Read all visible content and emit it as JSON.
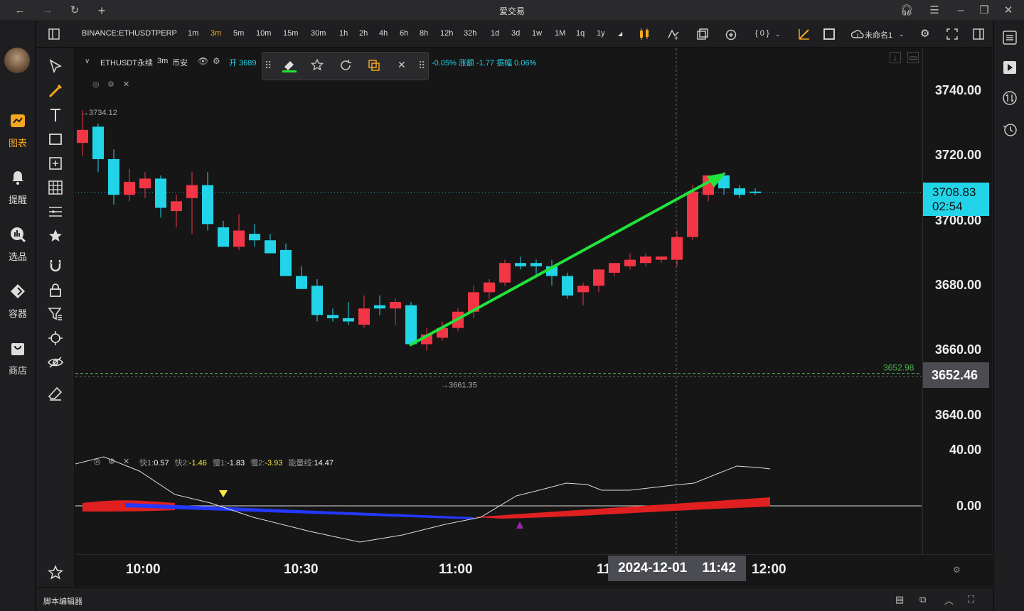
{
  "window": {
    "title": "爱交易"
  },
  "nav": {
    "items": [
      {
        "label": "图表",
        "active": true,
        "icon": "chart-icon"
      },
      {
        "label": "提醒",
        "icon": "bell-icon"
      },
      {
        "label": "选品",
        "icon": "screener-icon"
      },
      {
        "label": "容器",
        "icon": "container-icon"
      },
      {
        "label": "商店",
        "icon": "store-icon"
      }
    ]
  },
  "toolbar": {
    "symbol": "BINANCE:ETHUSDTPERP",
    "intervals": [
      "1m",
      "3m",
      "5m",
      "10m",
      "15m",
      "30m",
      "1h",
      "2h",
      "4h",
      "6h",
      "8h",
      "12h",
      "32h",
      "1d",
      "3d",
      "1w",
      "1M",
      "1q",
      "1y"
    ],
    "active_interval": "3m",
    "indicator_count": "{ 0 }",
    "layout_name": "未命名1"
  },
  "legend": {
    "name": "ETHUSDT永续",
    "interval": "3m",
    "exchange": "币安",
    "open_label": "开 3689",
    "change_text": "-0.05% 涨额 -1.77 振幅 0.06%"
  },
  "price_labels": {
    "high": "→3734.12",
    "low": "→3661.35",
    "line_label": "3652.98"
  },
  "price_axis": [
    "3740.00",
    "3720.00",
    "3700.00",
    "3680.00",
    "3660.00",
    "3640.00"
  ],
  "current_price": {
    "price": "3708.83",
    "countdown": "02:54"
  },
  "crosshair_price": "3652.46",
  "indicator": {
    "legend": [
      {
        "label": "快1:",
        "value": "0.57",
        "color": "#ffffff"
      },
      {
        "label": "快2:",
        "value": "-1.46",
        "color": "#ffeb3b"
      },
      {
        "label": "慢1:",
        "value": "-1.83",
        "color": "#ffffff"
      },
      {
        "label": "慢2:",
        "value": "-3.93",
        "color": "#ffeb3b"
      },
      {
        "label": "能量线:",
        "value": "14.47",
        "color": "#ffffff"
      }
    ],
    "axis": [
      "40.00",
      "0.00"
    ]
  },
  "time_axis": {
    "ticks": [
      "10:00",
      "10:30",
      "11:00",
      "11:42",
      "12:00"
    ],
    "crosshair_date": "2024-12-01",
    "crosshair_time": "11:42"
  },
  "bottom": {
    "label": "脚本编辑器"
  },
  "colors": {
    "up": "#f23645",
    "down": "#22d4e8",
    "arrow": "#21e33a"
  },
  "chart_data": {
    "type": "candlestick",
    "interval": "3m",
    "candles": [
      {
        "o": 3724,
        "h": 3734.12,
        "l": 3720,
        "c": 3728
      },
      {
        "o": 3729,
        "h": 3730,
        "l": 3715,
        "c": 3719
      },
      {
        "o": 3719,
        "h": 3722,
        "l": 3705,
        "c": 3708
      },
      {
        "o": 3708,
        "h": 3716,
        "l": 3706,
        "c": 3712
      },
      {
        "o": 3710,
        "h": 3715,
        "l": 3707,
        "c": 3713
      },
      {
        "o": 3713,
        "h": 3714,
        "l": 3701,
        "c": 3704
      },
      {
        "o": 3703,
        "h": 3708,
        "l": 3698,
        "c": 3706
      },
      {
        "o": 3707,
        "h": 3715,
        "l": 3696,
        "c": 3711
      },
      {
        "o": 3711,
        "h": 3715,
        "l": 3697,
        "c": 3699
      },
      {
        "o": 3698,
        "h": 3700,
        "l": 3692,
        "c": 3692
      },
      {
        "o": 3692,
        "h": 3702,
        "l": 3691,
        "c": 3697
      },
      {
        "o": 3696,
        "h": 3699,
        "l": 3692,
        "c": 3694
      },
      {
        "o": 3694,
        "h": 3696,
        "l": 3690,
        "c": 3690
      },
      {
        "o": 3691,
        "h": 3693,
        "l": 3683,
        "c": 3683
      },
      {
        "o": 3683,
        "h": 3686,
        "l": 3682,
        "c": 3679
      },
      {
        "o": 3680,
        "h": 3682,
        "l": 3669,
        "c": 3671
      },
      {
        "o": 3671,
        "h": 3673,
        "l": 3669,
        "c": 3670
      },
      {
        "o": 3670,
        "h": 3675,
        "l": 3668,
        "c": 3669
      },
      {
        "o": 3668,
        "h": 3677,
        "l": 3667,
        "c": 3673
      },
      {
        "o": 3674,
        "h": 3677,
        "l": 3671,
        "c": 3673
      },
      {
        "o": 3673,
        "h": 3676,
        "l": 3668,
        "c": 3675
      },
      {
        "o": 3674,
        "h": 3675,
        "l": 3661.35,
        "c": 3662
      },
      {
        "o": 3662,
        "h": 3667,
        "l": 3660,
        "c": 3665
      },
      {
        "o": 3664,
        "h": 3669,
        "l": 3663,
        "c": 3667
      },
      {
        "o": 3667,
        "h": 3673,
        "l": 3666,
        "c": 3672
      },
      {
        "o": 3672,
        "h": 3680,
        "l": 3670,
        "c": 3678
      },
      {
        "o": 3678,
        "h": 3682,
        "l": 3676,
        "c": 3681
      },
      {
        "o": 3681,
        "h": 3688,
        "l": 3680,
        "c": 3687
      },
      {
        "o": 3687,
        "h": 3689,
        "l": 3685,
        "c": 3686
      },
      {
        "o": 3687,
        "h": 3688,
        "l": 3683,
        "c": 3686
      },
      {
        "o": 3686,
        "h": 3688,
        "l": 3680,
        "c": 3683
      },
      {
        "o": 3683,
        "h": 3684,
        "l": 3676,
        "c": 3677
      },
      {
        "o": 3678,
        "h": 3681,
        "l": 3674,
        "c": 3680
      },
      {
        "o": 3680,
        "h": 3685,
        "l": 3678,
        "c": 3685
      },
      {
        "o": 3684,
        "h": 3687,
        "l": 3683,
        "c": 3687
      },
      {
        "o": 3686,
        "h": 3690,
        "l": 3685,
        "c": 3688
      },
      {
        "o": 3687,
        "h": 3690,
        "l": 3686,
        "c": 3689
      },
      {
        "o": 3688,
        "h": 3689,
        "l": 3687,
        "c": 3689
      },
      {
        "o": 3688,
        "h": 3697,
        "l": 3686,
        "c": 3695
      },
      {
        "o": 3695,
        "h": 3711,
        "l": 3694,
        "c": 3709
      },
      {
        "o": 3708,
        "h": 3714,
        "l": 3706,
        "c": 3714
      },
      {
        "o": 3714,
        "h": 3715,
        "l": 3708,
        "c": 3710
      },
      {
        "o": 3710,
        "h": 3711,
        "l": 3707,
        "c": 3708
      },
      {
        "o": 3709,
        "h": 3710,
        "l": 3708,
        "c": 3708.83
      }
    ]
  }
}
